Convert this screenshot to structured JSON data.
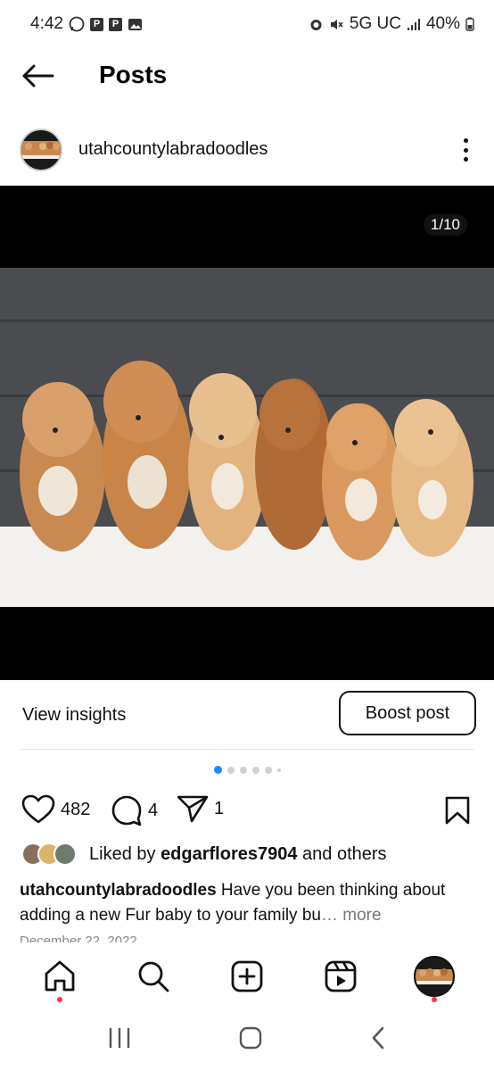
{
  "status_bar": {
    "time": "4:42",
    "network": "5G UC",
    "battery": "40%"
  },
  "header": {
    "title": "Posts"
  },
  "post": {
    "username": "utahcountylabradoodles",
    "media_counter": "1/10",
    "view_insights_label": "View insights",
    "boost_label": "Boost post",
    "carousel_pages": 6,
    "carousel_active": 1,
    "likes_count": "482",
    "comments_count": "4",
    "shares_count": "1",
    "liked_by_prefix": "Liked by ",
    "liked_by_user": "edgarflores7904",
    "liked_by_suffix": " and others",
    "caption_user": "utahcountylabradoodles",
    "caption_text": " Have you been thinking about adding a new Fur baby to your family bu",
    "caption_more": "… more",
    "date": "December 22, 2022"
  },
  "colors": {
    "accent": "#1a8cff",
    "notification": "#ff2d55",
    "muted": "#777777"
  },
  "icons": {
    "back": "arrow-left-icon",
    "more": "more-vertical-icon",
    "like": "heart-icon",
    "comment": "comment-icon",
    "share": "send-icon",
    "save": "bookmark-icon",
    "home": "home-icon",
    "search": "search-icon",
    "create": "plus-square-icon",
    "reels": "reels-icon"
  }
}
